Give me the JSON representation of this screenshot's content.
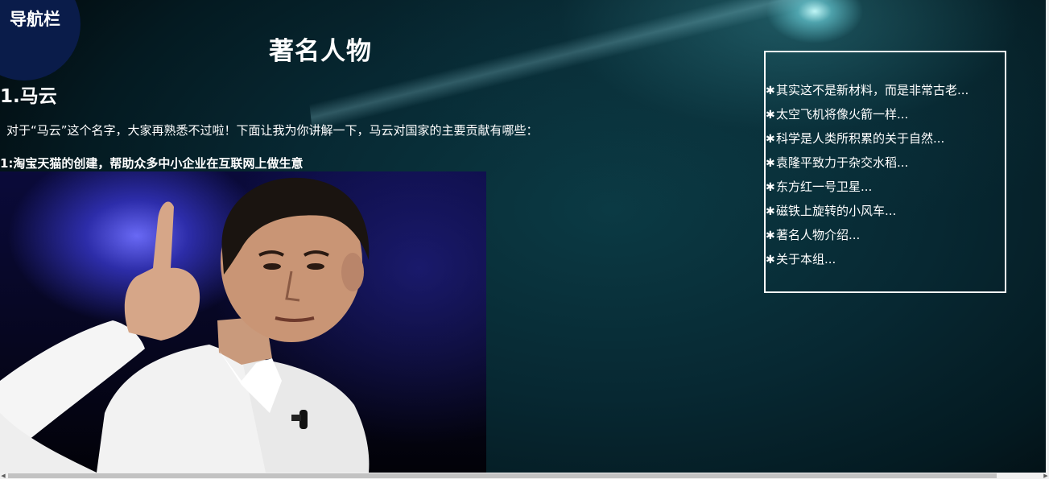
{
  "nav": {
    "title": "导航栏"
  },
  "page": {
    "title": "著名人物"
  },
  "section": {
    "heading": "1.马云",
    "intro": "对于“马云”这个名字，大家再熟悉不过啦！下面让我为你讲解一下，马云对国家的主要贡献有哪些：",
    "contribution": "1:淘宝天猫的创建，帮助众多中小企业在互联网上做生意"
  },
  "sidebar": {
    "star_glyph": "✱",
    "items": [
      {
        "label": "其实这不是新材料，而是非常古老..."
      },
      {
        "label": "太空飞机将像火箭一样..."
      },
      {
        "label": "科学是人类所积累的关于自然..."
      },
      {
        "label": "袁隆平致力于杂交水稻..."
      },
      {
        "label": "东方红一号卫星..."
      },
      {
        "label": "磁铁上旋转的小风车..."
      },
      {
        "label": "著名人物介绍..."
      },
      {
        "label": "关于本组..."
      }
    ]
  },
  "scrollbar": {
    "left_arrow": "◀",
    "right_arrow": "▶"
  },
  "colors": {
    "background": "#04161c",
    "nav_corner": "#0a1c4a",
    "text": "#ffffff",
    "sidebar_border": "#ffffff"
  }
}
